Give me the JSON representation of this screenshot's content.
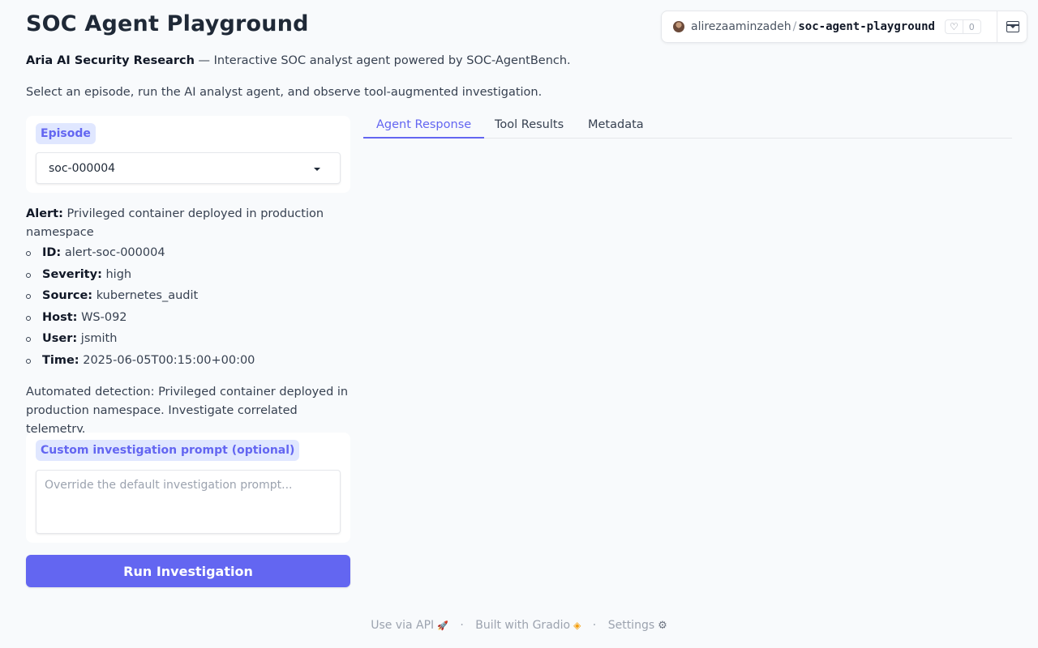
{
  "header": {
    "title": "SOC Agent Playground",
    "subtitle_bold": "Aria AI Security Research",
    "subtitle_rest": " — Interactive SOC analyst agent powered by SOC-AgentBench.",
    "instructions": "Select an episode, run the AI analyst agent, and observe tool-augmented investigation."
  },
  "hf_badge": {
    "owner": "alirezaaminzadeh",
    "separator": "/",
    "repo": "soc-agent-playground",
    "likes": "0",
    "heart_icon": "♡"
  },
  "episode": {
    "label": "Episode",
    "selected": "soc-000004"
  },
  "alert": {
    "label": "Alert:",
    "title": " Privileged container deployed in production namespace",
    "fields": [
      {
        "key": "ID:",
        "value": " alert-soc-000004"
      },
      {
        "key": "Severity:",
        "value": " high"
      },
      {
        "key": "Source:",
        "value": " kubernetes_audit"
      },
      {
        "key": "Host:",
        "value": " WS-092"
      },
      {
        "key": "User:",
        "value": " jsmith"
      },
      {
        "key": "Time:",
        "value": " 2025-06-05T00:15:00+00:00"
      }
    ],
    "detection": "Automated detection: Privileged container deployed in production namespace. Investigate correlated telemetry."
  },
  "prompt": {
    "label": "Custom investigation prompt (optional)",
    "value": "",
    "placeholder": "Override the default investigation prompt..."
  },
  "run_button": {
    "label": "Run Investigation"
  },
  "tabs": [
    {
      "label": "Agent Response",
      "active": true
    },
    {
      "label": "Tool Results",
      "active": false
    },
    {
      "label": "Metadata",
      "active": false
    }
  ],
  "footer": {
    "api": "Use via API",
    "built": "Built with Gradio",
    "settings": "Settings",
    "dot": "·",
    "rocket_icon": "🚀",
    "gradio_icon": "◈",
    "gear_icon": "⚙"
  },
  "colors": {
    "accent": "#6366f1",
    "accent_light": "#e0e7ff",
    "background": "#f8fafc"
  }
}
